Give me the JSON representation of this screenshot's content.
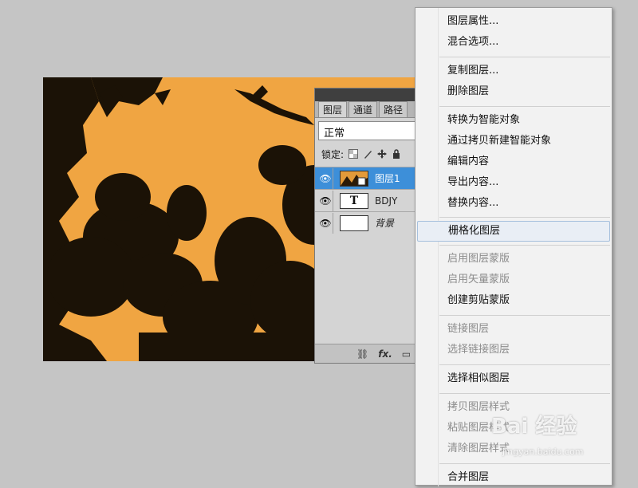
{
  "layers_panel": {
    "tabs": [
      "图层",
      "通道",
      "路径"
    ],
    "blend_mode": "正常",
    "lock_label": "锁定:",
    "layers": [
      {
        "name": "图层1",
        "selected": true,
        "thumb_icon": "smart-object-thumbnail"
      },
      {
        "name": "BDJY",
        "selected": false,
        "thumb_icon": "text-layer-T"
      },
      {
        "name": "背景",
        "selected": false,
        "thumb_icon": "blank-thumbnail"
      }
    ],
    "bottom_icons": [
      "link-icon",
      "fx-icon",
      "mask-icon"
    ],
    "fx_label": "fx."
  },
  "context_menu": {
    "items": [
      {
        "label": "图层属性...",
        "enabled": true
      },
      {
        "label": "混合选项...",
        "enabled": true
      },
      {
        "label": "复制图层...",
        "enabled": true
      },
      {
        "label": "删除图层",
        "enabled": true
      },
      {
        "label": "转换为智能对象",
        "enabled": true
      },
      {
        "label": "通过拷贝新建智能对象",
        "enabled": true
      },
      {
        "label": "编辑内容",
        "enabled": true
      },
      {
        "label": "导出内容...",
        "enabled": true
      },
      {
        "label": "替换内容...",
        "enabled": true
      },
      {
        "label": "栅格化图层",
        "enabled": true,
        "hover": true
      },
      {
        "label": "启用图层蒙版",
        "enabled": false
      },
      {
        "label": "启用矢量蒙版",
        "enabled": false
      },
      {
        "label": "创建剪贴蒙版",
        "enabled": true
      },
      {
        "label": "链接图层",
        "enabled": false
      },
      {
        "label": "选择链接图层",
        "enabled": false
      },
      {
        "label": "选择相似图层",
        "enabled": true
      },
      {
        "label": "拷贝图层样式",
        "enabled": false
      },
      {
        "label": "粘贴图层样式",
        "enabled": false
      },
      {
        "label": "清除图层样式",
        "enabled": false
      },
      {
        "label": "合并图层",
        "enabled": true
      }
    ]
  },
  "watermark": {
    "logo": "Bai 经验",
    "url": "jingyan.baidu.com"
  },
  "colors": {
    "canvas_sky": "#f0a542",
    "selection_blue": "#3d8fd9",
    "menu_bg": "#f2f2f2",
    "workspace_bg": "#c5c5c5"
  }
}
